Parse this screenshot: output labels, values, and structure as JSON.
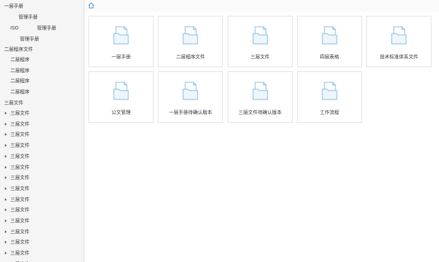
{
  "sidebar": {
    "items": [
      {
        "label": "一层手册",
        "caret": false
      },
      {
        "label": "管理手册",
        "caret": false
      },
      {
        "label": "ISO",
        "caret": false
      },
      {
        "label": "管理手册",
        "caret": false
      },
      {
        "label": "管理手册",
        "caret": false
      },
      {
        "label": "二层程序文件",
        "caret": false
      },
      {
        "label": "二层程序",
        "caret": false
      },
      {
        "label": "二层程序",
        "caret": false
      },
      {
        "label": "二层程序",
        "caret": false
      },
      {
        "label": "二层程序",
        "caret": false
      },
      {
        "label": "三层文件",
        "caret": false
      },
      {
        "label": "三层文件",
        "caret": true
      },
      {
        "label": "三层文件",
        "caret": true
      },
      {
        "label": "三层文件",
        "caret": true
      },
      {
        "label": "三层文件",
        "caret": true
      },
      {
        "label": "三层文件",
        "caret": true
      },
      {
        "label": "三层文件",
        "caret": true
      },
      {
        "label": "三层文件",
        "caret": true
      },
      {
        "label": "三层文件",
        "caret": true
      },
      {
        "label": "三层文件",
        "caret": true
      },
      {
        "label": "三层文件",
        "caret": true
      },
      {
        "label": "三层文件",
        "caret": true
      },
      {
        "label": "三层文件",
        "caret": true
      },
      {
        "label": "三层文件",
        "caret": true
      },
      {
        "label": "三层文件",
        "caret": true
      },
      {
        "label": "三层文件",
        "caret": true
      }
    ]
  },
  "topbar": {
    "home_icon": "home-icon"
  },
  "tiles": [
    {
      "label": "一层手册",
      "icon": "folder-icon"
    },
    {
      "label": "二层程序文件",
      "icon": "folder-icon"
    },
    {
      "label": "三层文件",
      "icon": "folder-icon"
    },
    {
      "label": "四层表格",
      "icon": "folder-icon"
    },
    {
      "label": "技术标准体系文件",
      "icon": "folder-icon"
    },
    {
      "label": "公文管理",
      "icon": "folder-icon"
    },
    {
      "label": "一层手册待确认版本",
      "icon": "folder-icon"
    },
    {
      "label": "三层文件待确认版本",
      "icon": "folder-icon"
    },
    {
      "label": "工作流程",
      "icon": "folder-icon"
    }
  ],
  "colors": {
    "icon_stroke": "#7fb8e0",
    "icon_fill": "#eef6fc",
    "sidebar_bg": "#f5f5f5",
    "tile_border": "#e2e2e2"
  }
}
